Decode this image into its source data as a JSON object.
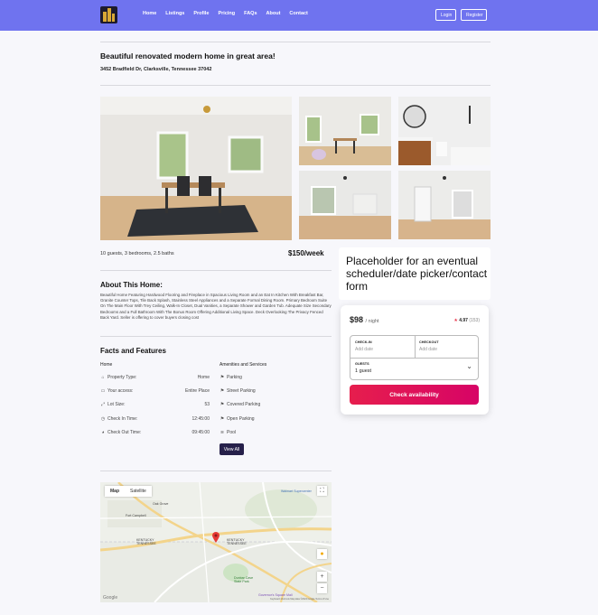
{
  "nav": {
    "links": [
      "Home",
      "Listings",
      "Profile",
      "Pricing",
      "FAQs",
      "About",
      "Contact"
    ],
    "login_label": "Login",
    "register_label": "Register",
    "bg_color": "#6f73ef"
  },
  "listing": {
    "title": "Beautiful renovated modern home in great area!",
    "address": "3452 Bradfield Dr, Clarksville, Tennessee 37042",
    "summary": "10 guests, 3 bedrooms, 2.5 baths",
    "price_week": "$150/week"
  },
  "about": {
    "heading": "About This Home:",
    "text": "Beautiful Home Featuring Hardwood Flooring and Fireplace in Spacious Living Room and an Eat In Kitchen With Breakfast Bar, Granite Counter Tops, Tile Back Splash, Stainless Steel Appliances and a Separate Formal Dining Room. Primary Bedroom Suite On The Main Floor With Trey Ceiling, Walk-In Closet, Dual Vanities, a Separate Shower and Garden Tub. Adequate Size Secondary Bedrooms and a Full Bathroom With The Bonus Room Offering Additional Living Space. Deck Overlooking The Privacy Fenced Back Yard. Seller is offering to cover buyers closing cost"
  },
  "facts": {
    "heading": "Facts and Features",
    "home_label": "Home",
    "amenities_label": "Amenities and Services",
    "rows": [
      {
        "label": "Property Type:",
        "value": "Home",
        "icon": "home-icon"
      },
      {
        "label": "Your access:",
        "value": "Entire Place",
        "icon": "key-icon"
      },
      {
        "label": "Lot Size:",
        "value": "53",
        "icon": "ruler-icon"
      },
      {
        "label": "Check In Time:",
        "value": "12:45:00",
        "icon": "clock-icon"
      },
      {
        "label": "Check Out Time:",
        "value": "09:45:00",
        "icon": "clock-filled-icon"
      }
    ],
    "amenities": [
      {
        "label": "Parking",
        "icon": "car-icon"
      },
      {
        "label": "Street Parking",
        "icon": "road-icon"
      },
      {
        "label": "Covered Parking",
        "icon": "garage-icon"
      },
      {
        "label": "Open Parking",
        "icon": "open-lot-icon"
      },
      {
        "label": "Pool",
        "icon": "pool-icon"
      }
    ],
    "view_all_label": "View All"
  },
  "map": {
    "tab_map": "Map",
    "tab_satellite": "Satellite",
    "labels": {
      "oak_grove": "Oak Grove",
      "fort_campbell": "Fort Campbell",
      "kentucky_tn": "KENTUCKY TENNESSEE",
      "kentucky_tn_left": "KENTUCKY TENNESSEE",
      "dunbar": "Dunbar Cave State Park",
      "mall": "Governor's Square Mall",
      "walmart": "Walmart Supercenter"
    },
    "google": "Google",
    "footer": "Keyboard shortcuts   Map data ©2024 Google   Terms of Use"
  },
  "scheduler": {
    "text": "Placeholder for an eventual scheduler/date picker/contact form"
  },
  "booking": {
    "price": "$98",
    "per": "/ night",
    "rating": "4.97",
    "count": "(153)",
    "checkin_label": "CHECK-IN",
    "checkin_ph": "Add date",
    "checkout_label": "CHECKOUT",
    "checkout_ph": "Add date",
    "guests_label": "GUESTS",
    "guests_value": "1 guest",
    "button": "Check availability",
    "accent": "#e61e4d"
  }
}
